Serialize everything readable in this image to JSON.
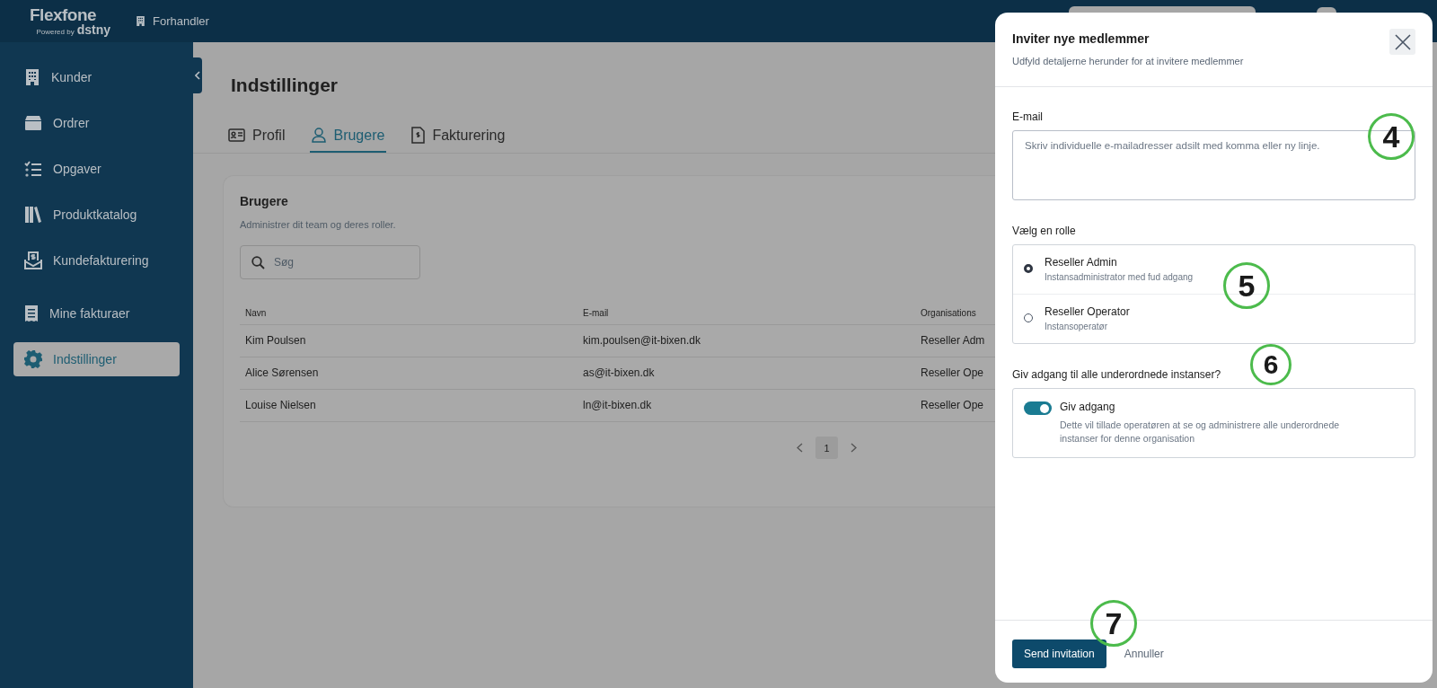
{
  "header": {
    "logo": {
      "name": "Flexfone",
      "tagline_prefix": "Powered by",
      "tagline_brand": "dstny"
    },
    "context": "Forhandler"
  },
  "sidebar": {
    "items": [
      {
        "label": "Kunder",
        "kind": "building",
        "selected": false
      },
      {
        "label": "Ordrer",
        "kind": "box",
        "selected": false
      },
      {
        "label": "Opgaver",
        "kind": "checklist",
        "selected": false
      },
      {
        "label": "Produktkatalog",
        "kind": "books",
        "selected": false
      },
      {
        "label": "Kundefakturering",
        "kind": "invoice-tray",
        "selected": false
      },
      {
        "label": "Mine fakturaer",
        "kind": "receipt",
        "selected": false
      },
      {
        "label": "Indstillinger",
        "kind": "gear",
        "selected": true
      }
    ]
  },
  "page": {
    "title": "Indstillinger",
    "tabs": [
      {
        "label": "Profil",
        "kind": "id-card",
        "selected": false
      },
      {
        "label": "Brugere",
        "kind": "user",
        "selected": true
      },
      {
        "label": "Fakturering",
        "kind": "document",
        "selected": false
      }
    ],
    "card": {
      "title": "Brugere",
      "subtitle": "Administrer dit team og deres roller.",
      "search": {
        "placeholder": "Søg"
      },
      "table": {
        "columns": [
          "Navn",
          "E-mail",
          "Organisations"
        ],
        "rows": [
          [
            "Kim Poulsen",
            "kim.poulsen@it-bixen.dk",
            "Reseller Adm"
          ],
          [
            "Alice Sørensen",
            "as@it-bixen.dk",
            "Reseller Ope"
          ],
          [
            "Louise Nielsen",
            "ln@it-bixen.dk",
            "Reseller Ope"
          ]
        ]
      },
      "pagination": {
        "pages": [
          {
            "label": "1",
            "selected": true
          }
        ]
      }
    }
  },
  "modal": {
    "title": "Inviter nye medlemmer",
    "subtitle": "Udfyld detaljerne herunder for at invitere medlemmer",
    "email": {
      "label": "E-mail",
      "placeholder": "Skriv individuelle e-mailadresser adsilt med komma eller ny linje."
    },
    "role": {
      "label": "Vælg en rolle",
      "options": [
        {
          "title": "Reseller Admin",
          "description": "Instansadministrator med fud adgang",
          "selected": true
        },
        {
          "title": "Reseller Operator",
          "description": "Instansoperatør",
          "selected": false
        }
      ]
    },
    "access": {
      "question": "Giv adgang til alle underordnede instanser?",
      "toggle": {
        "label": "Giv adgang",
        "on": true,
        "description": "Dette vil tillade operatøren at se og administrere alle underordnede instanser for denne organisation"
      }
    },
    "buttons": [
      {
        "label": "Send invitation",
        "kind": "primary"
      },
      {
        "label": "Annuller",
        "kind": "link"
      }
    ]
  },
  "callouts": [
    "4",
    "5",
    "6",
    "7"
  ]
}
